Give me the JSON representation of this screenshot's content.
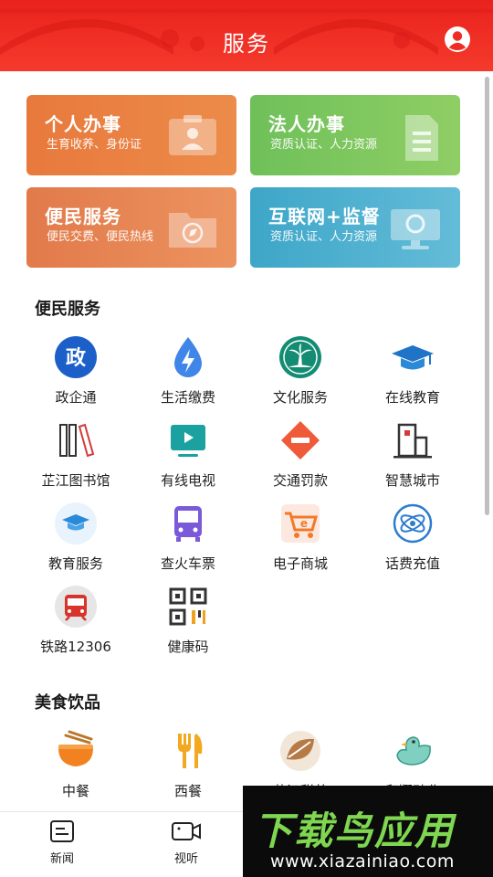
{
  "header": {
    "title": "服务",
    "avatar_icon": "user-circle-icon"
  },
  "cards": [
    {
      "title": "个人办事",
      "subtitle": "生育收养、身份证",
      "icon": "id-card-icon",
      "color": "#e8793d"
    },
    {
      "title": "法人办事",
      "subtitle": "资质认证、人力资源",
      "icon": "document-icon",
      "color": "#7cc65e"
    },
    {
      "title": "便民服务",
      "subtitle": "便民交费、便民热线",
      "icon": "folder-compass-icon",
      "color": "#e57f4f"
    },
    {
      "title": "互联网+监督",
      "subtitle": "资质认证、人力资源",
      "icon": "monitor-icon",
      "color": "#4fb0d0"
    }
  ],
  "sections": {
    "convenience": {
      "title": "便民服务",
      "items": [
        {
          "label": "政企通",
          "icon": "zheng-badge-icon"
        },
        {
          "label": "生活缴费",
          "icon": "water-drop-bolt-icon"
        },
        {
          "label": "文化服务",
          "icon": "palm-tree-icon"
        },
        {
          "label": "在线教育",
          "icon": "graduation-cap-icon"
        },
        {
          "label": "芷江图书馆",
          "icon": "books-icon"
        },
        {
          "label": "有线电视",
          "icon": "tv-play-icon"
        },
        {
          "label": "交通罚款",
          "icon": "no-entry-icon"
        },
        {
          "label": "智慧城市",
          "icon": "building-icon"
        },
        {
          "label": "教育服务",
          "icon": "graduation-badge-icon"
        },
        {
          "label": "查火车票",
          "icon": "bus-icon"
        },
        {
          "label": "电子商城",
          "icon": "shopping-cart-icon"
        },
        {
          "label": "话费充值",
          "icon": "atom-icon"
        },
        {
          "label": "铁路12306",
          "icon": "train-icon"
        },
        {
          "label": "健康码",
          "icon": "qr-code-icon"
        }
      ]
    },
    "food": {
      "title": "美食饮品",
      "items": [
        {
          "label": "中餐",
          "icon": "noodle-bowl-icon"
        },
        {
          "label": "西餐",
          "icon": "fork-knife-icon"
        },
        {
          "label": "芷江甜茶",
          "icon": "tea-leaf-icon"
        },
        {
          "label": "和翔鸭业",
          "icon": "duck-icon"
        }
      ]
    }
  },
  "bottom_nav": [
    {
      "label": "新闻",
      "icon": "news-icon"
    },
    {
      "label": "视听",
      "icon": "video-camera-icon"
    }
  ],
  "watermark": {
    "line1": "下载鸟应用",
    "line2": "www.xiazainiao.com"
  }
}
